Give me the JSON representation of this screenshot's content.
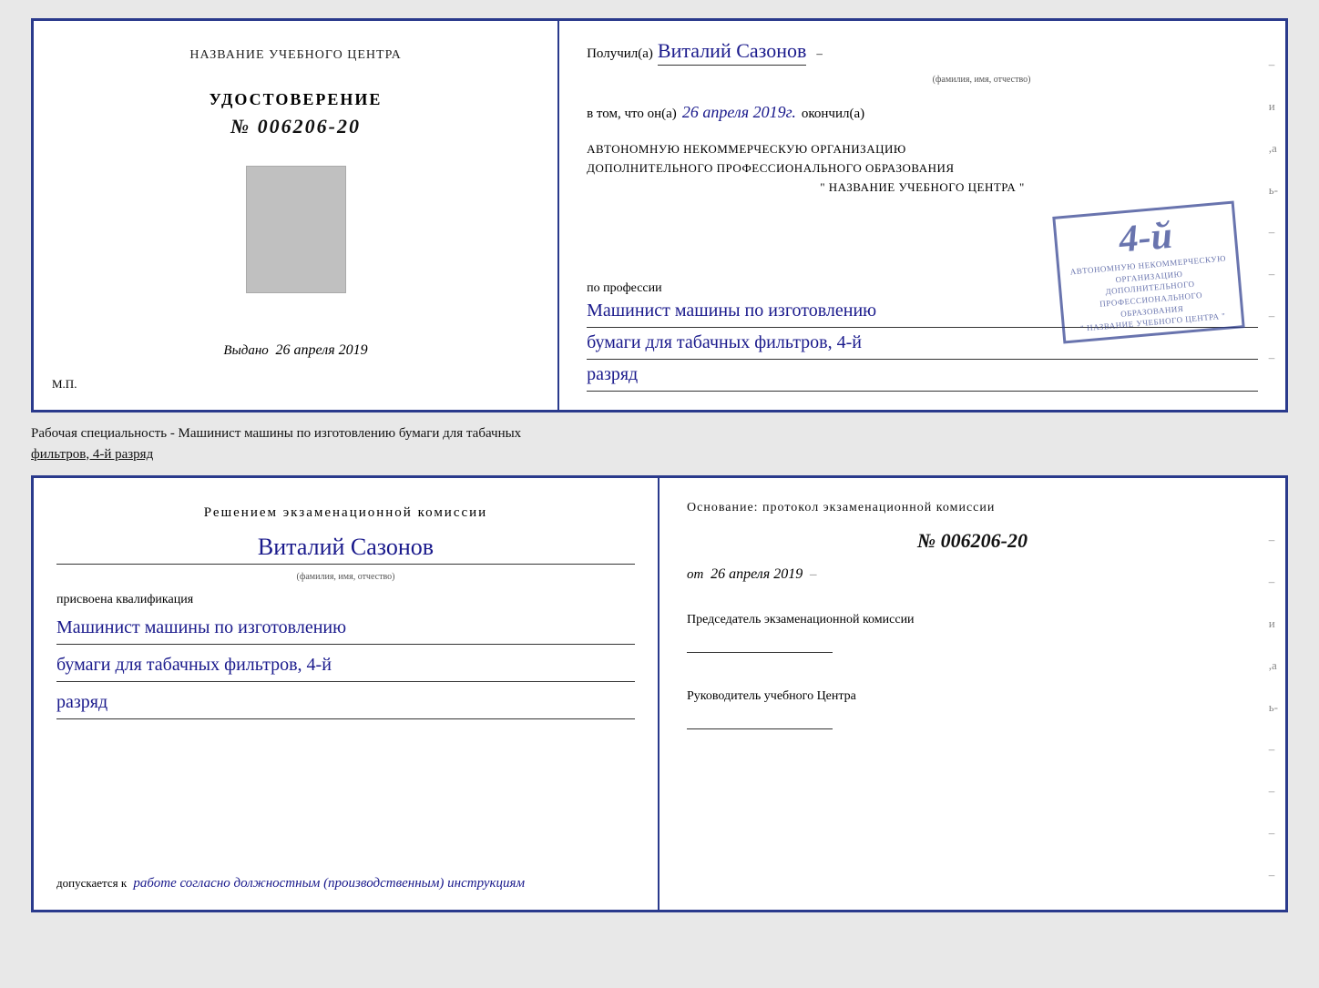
{
  "page": {
    "background_color": "#e8e8e8"
  },
  "top_cert": {
    "left": {
      "training_center_label": "НАЗВАНИЕ УЧЕБНОГО ЦЕНТРА",
      "cert_title": "УДОСТОВЕРЕНИЕ",
      "cert_number": "№ 006206-20",
      "issued_label": "Выдано",
      "issued_date": "26 апреля 2019",
      "mp_label": "М.П."
    },
    "right": {
      "recipient_prefix": "Получил(а)",
      "recipient_name": "Виталий Сазонов",
      "recipient_subtitle": "(фамилия, имя, отчество)",
      "vtom_prefix": "в том, что он(а)",
      "vtom_date": "26 апреля 2019г.",
      "vtom_suffix": "окончил(а)",
      "stamp": {
        "number": "4-й",
        "line1": "АВТОНОМНУЮ НЕКОММЕРЧЕСКУЮ ОРГАНИЗАЦИЮ",
        "line2": "ДОПОЛНИТЕЛЬНОГО ПРОФЕССИОНАЛЬНОГО ОБРАЗОВАНИЯ",
        "line3": "\" НАЗВАНИЕ УЧЕБНОГО ЦЕНТРА \""
      },
      "profession_label": "по профессии",
      "profession_line1": "Машинист машины по изготовлению",
      "profession_line2": "бумаги для табачных фильтров, 4-й",
      "profession_line3": "разряд"
    }
  },
  "separator": {
    "text": "Рабочая специальность - Машинист машины по изготовлению бумаги для табачных",
    "text2": "фильтров, 4-й разряд"
  },
  "bottom_cert": {
    "left": {
      "commission_title": "Решением экзаменационной комиссии",
      "person_name": "Виталий Сазонов",
      "person_subtitle": "(фамилия, имя, отчество)",
      "assigned_label": "присвоена квалификация",
      "qualification_line1": "Машинист машины по изготовлению",
      "qualification_line2": "бумаги для табачных фильтров, 4-й",
      "qualification_line3": "разряд",
      "allowed_prefix": "допускается к",
      "allowed_text": "работе согласно должностным (производственным) инструкциям"
    },
    "right": {
      "basis_label": "Основание: протокол экзаменационной комиссии",
      "number_label": "№ 006206-20",
      "date_prefix": "от",
      "date_value": "26 апреля 2019",
      "chairman_label": "Председатель экзаменационной комиссии",
      "director_label": "Руководитель учебного Центра"
    }
  }
}
